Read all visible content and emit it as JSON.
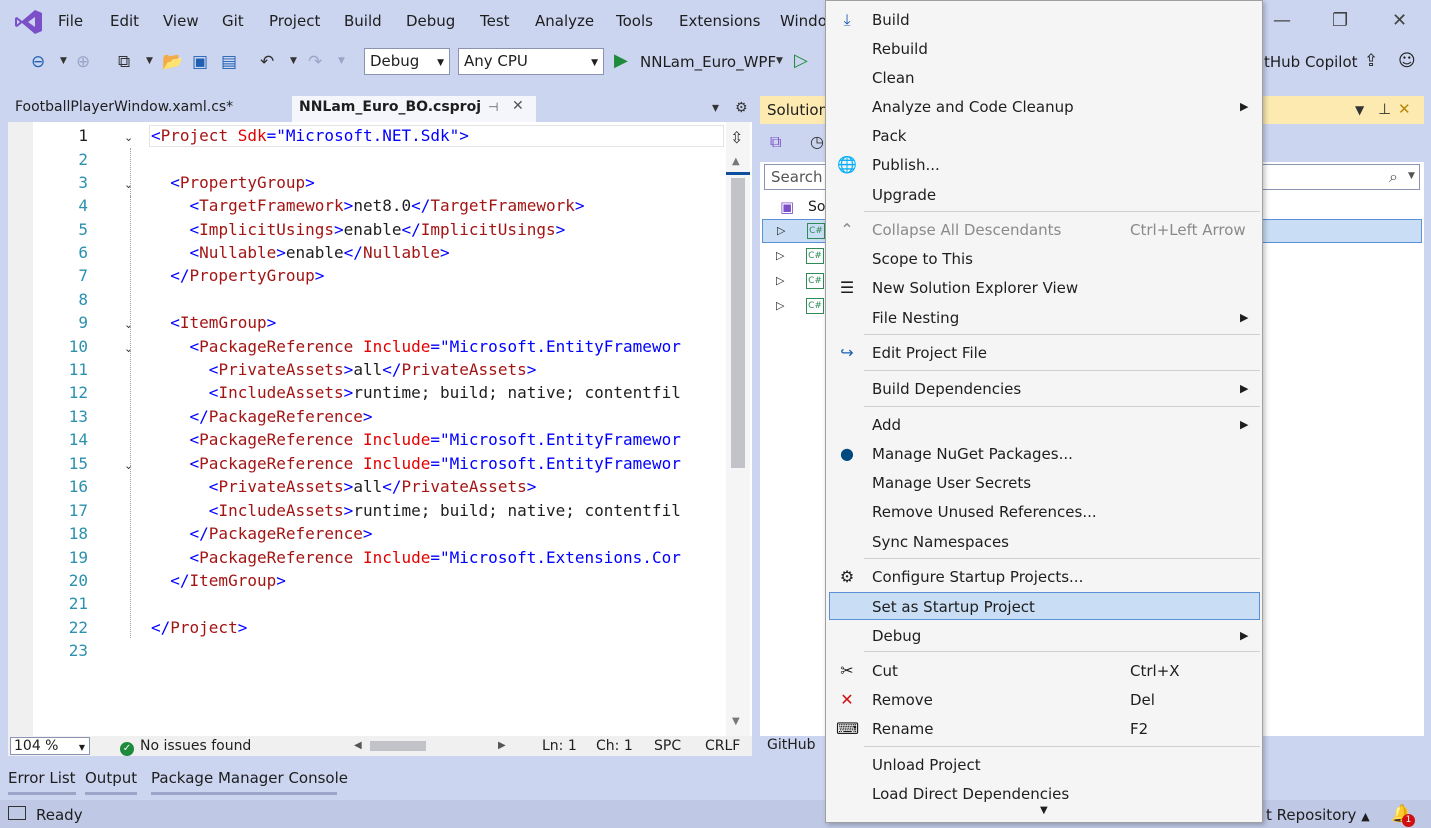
{
  "menubar": {
    "items": [
      "File",
      "Edit",
      "View",
      "Git",
      "Project",
      "Build",
      "Debug",
      "Test",
      "Analyze",
      "Tools",
      "Extensions",
      "Windo"
    ]
  },
  "toolbar": {
    "config": "Debug",
    "platform": "Any CPU",
    "start_project": "NNLam_Euro_WPF",
    "copilot": "tHub Copilot"
  },
  "tabs": [
    {
      "label": "FootballPlayerWindow.xaml.cs*"
    },
    {
      "label": "NNLam_Euro_BO.csproj"
    }
  ],
  "editor": {
    "line_numbers": [
      "1",
      "2",
      "3",
      "4",
      "5",
      "6",
      "7",
      "8",
      "9",
      "10",
      "11",
      "12",
      "13",
      "14",
      "15",
      "16",
      "17",
      "18",
      "19",
      "20",
      "21",
      "22",
      "23"
    ],
    "status": {
      "zoom": "104 %",
      "issues": "No issues found",
      "ln": "Ln: 1",
      "ch": "Ch: 1",
      "spc": "SPC",
      "crlf": "CRLF"
    }
  },
  "solution_explorer": {
    "title": "Solution",
    "search_placeholder": "Search S",
    "solution_node": "So",
    "footer": "GitHub"
  },
  "bottom_tabs": [
    "Error List",
    "Output",
    "Package Manager Console"
  ],
  "statusbar": {
    "ready": "Ready",
    "repo": "t Repository",
    "notifications": "1"
  },
  "context_menu": {
    "items": [
      {
        "label": "Build",
        "icon": "build-icon"
      },
      {
        "label": "Rebuild"
      },
      {
        "label": "Clean"
      },
      {
        "label": "Analyze and Code Cleanup",
        "submenu": true
      },
      {
        "label": "Pack"
      },
      {
        "label": "Publish...",
        "icon": "globe-icon"
      },
      {
        "label": "Upgrade"
      },
      {
        "label": "Collapse All Descendants",
        "shortcut": "Ctrl+Left Arrow",
        "disabled": true,
        "icon": "collapse-icon"
      },
      {
        "label": "Scope to This"
      },
      {
        "label": "New Solution Explorer View",
        "icon": "new-view-icon"
      },
      {
        "label": "File Nesting",
        "submenu": true
      },
      {
        "label": "Edit Project File",
        "icon": "edit-project-icon"
      },
      {
        "label": "Build Dependencies",
        "submenu": true
      },
      {
        "label": "Add",
        "submenu": true
      },
      {
        "label": "Manage NuGet Packages...",
        "icon": "nuget-icon"
      },
      {
        "label": "Manage User Secrets"
      },
      {
        "label": "Remove Unused References..."
      },
      {
        "label": "Sync Namespaces"
      },
      {
        "label": "Configure Startup Projects...",
        "icon": "gear-icon"
      },
      {
        "label": "Set as Startup Project",
        "selected": true
      },
      {
        "label": "Debug",
        "submenu": true
      },
      {
        "label": "Cut",
        "shortcut": "Ctrl+X",
        "icon": "scissors-icon"
      },
      {
        "label": "Remove",
        "shortcut": "Del",
        "icon": "remove-x-icon"
      },
      {
        "label": "Rename",
        "shortcut": "F2",
        "icon": "rename-icon"
      },
      {
        "label": "Unload Project"
      },
      {
        "label": "Load Direct Dependencies"
      }
    ]
  },
  "colors": {
    "chrome": "#CCD5F0",
    "selection": "#C9DEF5",
    "xml_tag": "#A31515",
    "xml_bracket": "#0000FF",
    "xml_attr": "#E50000"
  }
}
